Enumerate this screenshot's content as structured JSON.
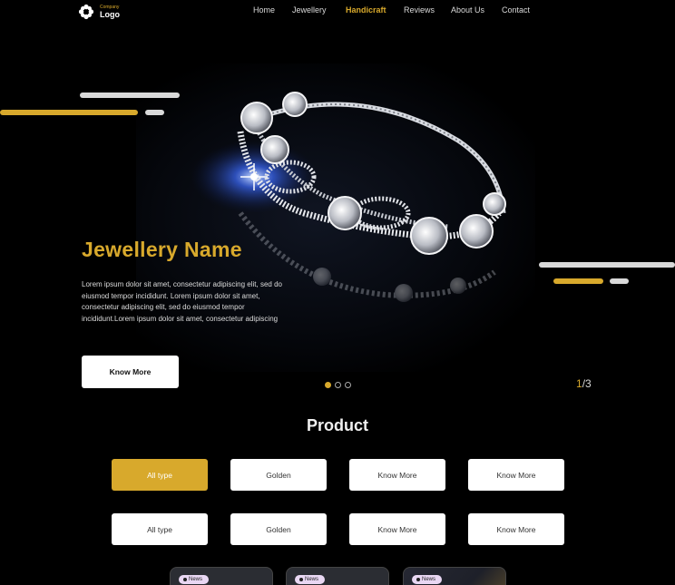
{
  "header": {
    "logo_company": "Company",
    "logo_text": "Logo",
    "nav": [
      {
        "label": "Home",
        "active": false
      },
      {
        "label": "Jewellery",
        "active": false
      },
      {
        "label": "Handicraft",
        "active": true
      },
      {
        "label": "Reviews",
        "active": false
      },
      {
        "label": "About Us",
        "active": false
      },
      {
        "label": "Contact",
        "active": false
      }
    ]
  },
  "hero": {
    "title": "Jewellery Name",
    "description": "Lorem ipsum dolor sit amet, consectetur adipiscing elit, sed do eiusmod tempor incididunt. Lorem ipsum dolor sit amet, consectetur adipiscing elit, sed do eiusmod tempor incididunt.Lorem ipsum dolor sit amet, consectetur adipiscing",
    "button_label": "Know More",
    "slide_current": "1",
    "slide_total": "/3",
    "image": "diamond-bracelet"
  },
  "products": {
    "title": "Product",
    "filter_row_1": [
      "All type",
      "Golden",
      "Know More",
      "Know More"
    ],
    "filter_row_2": [
      "All type",
      "Golden",
      "Know More",
      "Know More"
    ],
    "cards": [
      {
        "tag": "News"
      },
      {
        "tag": "News"
      },
      {
        "tag": "News"
      }
    ]
  },
  "colors": {
    "accent": "#d8a92c",
    "background": "#000000",
    "text": "#ffffff"
  }
}
